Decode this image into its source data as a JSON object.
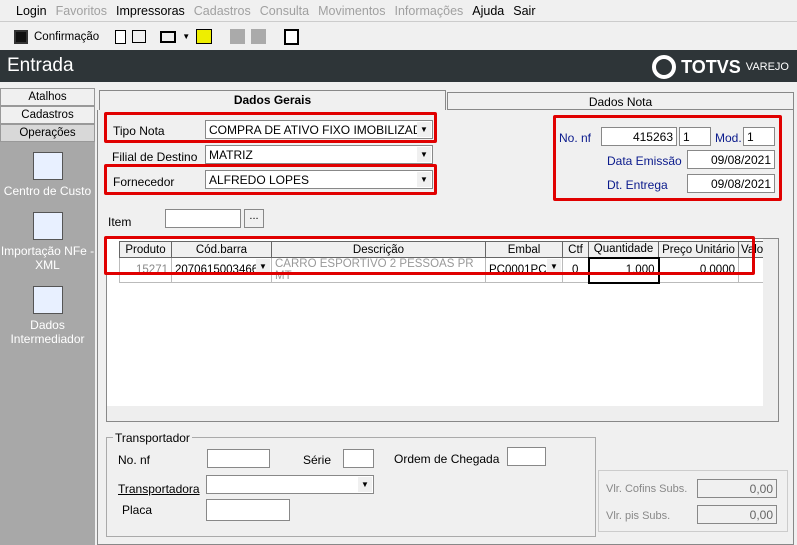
{
  "menu": [
    "Login",
    "Favoritos",
    "Impressoras",
    "Cadastros",
    "Consulta",
    "Movimentos",
    "Informações",
    "Ajuda",
    "Sair"
  ],
  "toolbar": {
    "confirm": "Confirmação"
  },
  "header": {
    "title": "Entrada",
    "brand": "TOTVS",
    "brand_sub": "VAREJO"
  },
  "sidebar": {
    "tabs": [
      "Atalhos",
      "Cadastros",
      "Operações"
    ],
    "items": [
      "Centro de Custo",
      "Importação NFe - XML",
      "Dados Intermediador"
    ]
  },
  "tabs": [
    "Dados Gerais",
    "Dados Nota"
  ],
  "form": {
    "tipo_nota_label": "Tipo Nota",
    "tipo_nota": "COMPRA DE ATIVO FIXO IMOBILIZADO",
    "filial_label": "Filial de Destino",
    "filial": "MATRIZ",
    "fornecedor_label": "Fornecedor",
    "fornecedor": "ALFREDO LOPES",
    "item_label": "Item",
    "item_btn": "..."
  },
  "nf": {
    "no_nf_label": "No. nf",
    "no_nf": "415263",
    "serie": "1",
    "mod_label": "Mod.",
    "mod": "1",
    "emissao_label": "Data Emissão",
    "emissao": "09/08/2021",
    "entrega_label": "Dt. Entrega",
    "entrega": "09/08/2021"
  },
  "grid": {
    "headers": [
      "Produto",
      "Cód.barra",
      "Descrição",
      "Embal",
      "Ctf",
      "Quantidade",
      "Preço Unitário",
      "Valo"
    ],
    "rows": [
      [
        "15271",
        "2070615003466",
        "CARRO ESPORTIVO 2 PESSOAS  PR MT",
        "PC0001PC",
        "0",
        "1,000",
        "0,0000"
      ]
    ]
  },
  "transp": {
    "title": "Transportador",
    "no_nf_label": "No. nf",
    "serie_label": "Série",
    "ordem_label": "Ordem de Chegada",
    "transportadora_label": "Transportadora",
    "placa_label": "Placa"
  },
  "totals": {
    "cofins_label": "Vlr. Cofins Subs.",
    "cofins": "0,00",
    "pis_label": "Vlr. pis Subs.",
    "pis": "0,00"
  }
}
